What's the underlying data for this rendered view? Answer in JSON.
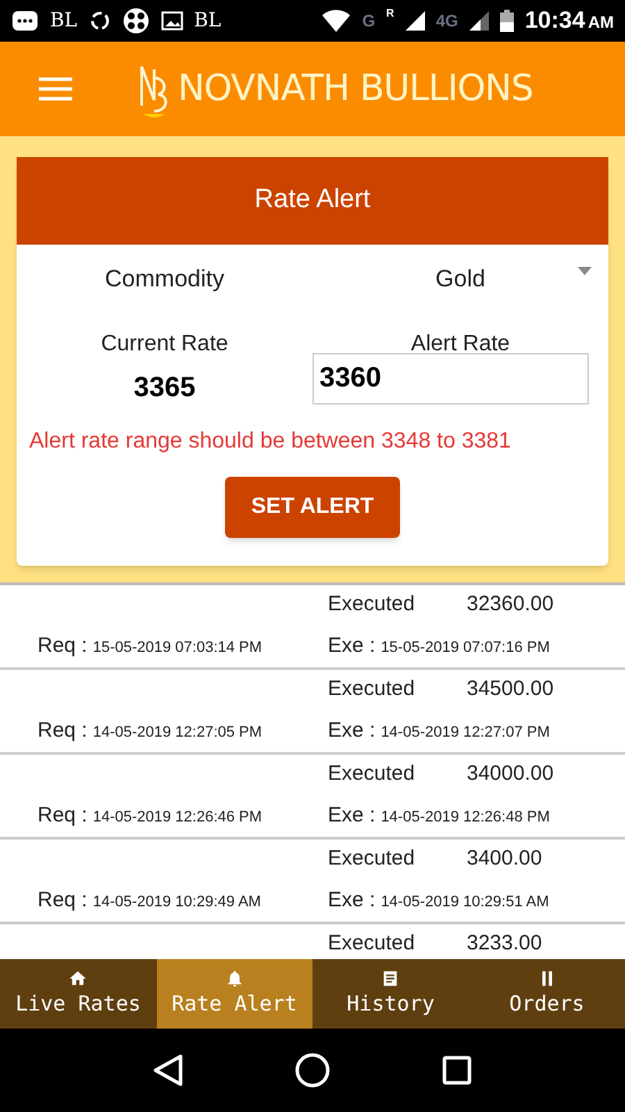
{
  "status_bar": {
    "left": [
      "BL",
      "BL"
    ],
    "network": [
      "G",
      "R",
      "4G"
    ],
    "time": "10:34",
    "ampm": "AM"
  },
  "header": {
    "brand": "NOVNATH BULLIONS"
  },
  "rate_alert": {
    "title": "Rate Alert",
    "commodity_label": "Commodity",
    "commodity_value": "Gold",
    "current_rate_label": "Current Rate",
    "current_rate": "3365",
    "alert_rate_label": "Alert Rate",
    "alert_rate_value": "3360",
    "error": "Alert rate range should be between 3348 to 3381",
    "button": "SET ALERT"
  },
  "alerts": [
    {
      "status": "Executed",
      "amount": "32360.00",
      "req_label": "Req :",
      "req_time": "15-05-2019 07:03:14 PM",
      "exe_label": "Exe :",
      "exe_time": "15-05-2019 07:07:16 PM"
    },
    {
      "status": "Executed",
      "amount": "34500.00",
      "req_label": "Req :",
      "req_time": "14-05-2019 12:27:05 PM",
      "exe_label": "Exe :",
      "exe_time": "14-05-2019 12:27:07 PM"
    },
    {
      "status": "Executed",
      "amount": "34000.00",
      "req_label": "Req :",
      "req_time": "14-05-2019 12:26:46 PM",
      "exe_label": "Exe :",
      "exe_time": "14-05-2019 12:26:48 PM"
    },
    {
      "status": "Executed",
      "amount": "3400.00",
      "req_label": "Req :",
      "req_time": "14-05-2019 10:29:49 AM",
      "exe_label": "Exe :",
      "exe_time": "14-05-2019 10:29:51 AM"
    },
    {
      "status": "Executed",
      "amount": "3233.00"
    }
  ],
  "bottom_nav": [
    {
      "label": "Live Rates",
      "kind": "home",
      "selected": false
    },
    {
      "label": "Rate Alert",
      "kind": "bell",
      "selected": true
    },
    {
      "label": "History",
      "kind": "doc",
      "selected": false
    },
    {
      "label": "Orders",
      "kind": "pause",
      "selected": false
    }
  ]
}
